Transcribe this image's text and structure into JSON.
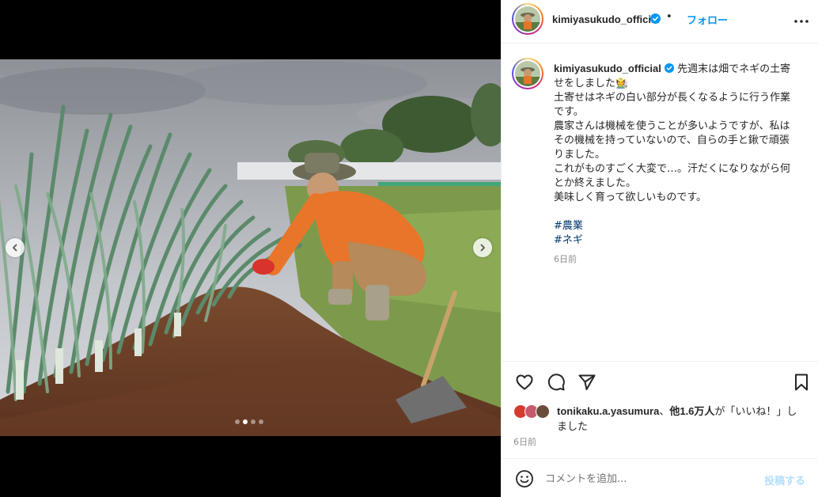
{
  "post": {
    "username": "kimiyasukudo_official",
    "follow_label": "フォロー",
    "header_separator": "•",
    "more_icon": "more-horizontal-icon",
    "verified_icon": "verified-badge-icon"
  },
  "caption": {
    "username": "kimiyasukudo_official",
    "first_line": "先週末は畑でネギの土寄",
    "lines": [
      "せをしました🧑‍🌾",
      "土寄せはネギの白い部分が長くなるように行う作業",
      "です。",
      "農家さんは機械を使うことが多いようですが、私は",
      "その機械を持っていないので、自らの手と鍬で頑張",
      "りました。",
      "これがものすごく大変で…。汗だくになりながら何",
      "とか終えました。",
      "美味しく育って欲しいものです。"
    ],
    "hashtags": [
      "#農業",
      "#ネギ"
    ],
    "time": "6日前"
  },
  "actions": {
    "like_icon": "heart-icon",
    "comment_icon": "comment-bubble-icon",
    "share_icon": "paper-plane-icon",
    "save_icon": "bookmark-icon"
  },
  "likes": {
    "user": "tonikaku.a.yasumura",
    "sep": "、",
    "count": "他1.6万人",
    "suffix_1": "が「いいね！」し",
    "suffix_2": "ました",
    "time": "6日前"
  },
  "comment": {
    "placeholder": "コメントを追加...",
    "post_label": "投稿する",
    "emoji_icon": "smiley-icon"
  },
  "carousel": {
    "slide_count": 4,
    "active_index": 1,
    "prev_icon": "chevron-left-icon",
    "next_icon": "chevron-right-icon"
  },
  "colors": {
    "accent": "#0095f6",
    "hashtag": "#00376b",
    "muted": "#8e8e8e",
    "post_disabled": "#b2dffc"
  }
}
